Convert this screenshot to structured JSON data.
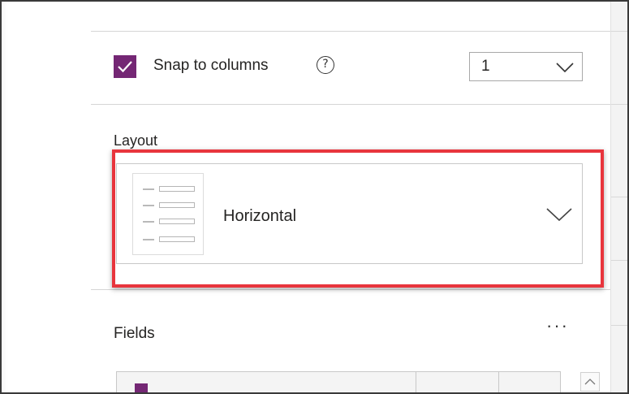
{
  "snap": {
    "label": "Snap to columns",
    "checked": true,
    "help_icon": "?",
    "columns_value": "1"
  },
  "layout": {
    "label": "Layout",
    "value": "Horizontal",
    "thumbnail_icon": "horizontal-layout-thumbnail"
  },
  "fields": {
    "label": "Fields",
    "more_label": "···"
  },
  "colors": {
    "accent": "#742774",
    "highlight": "#e8353d"
  }
}
